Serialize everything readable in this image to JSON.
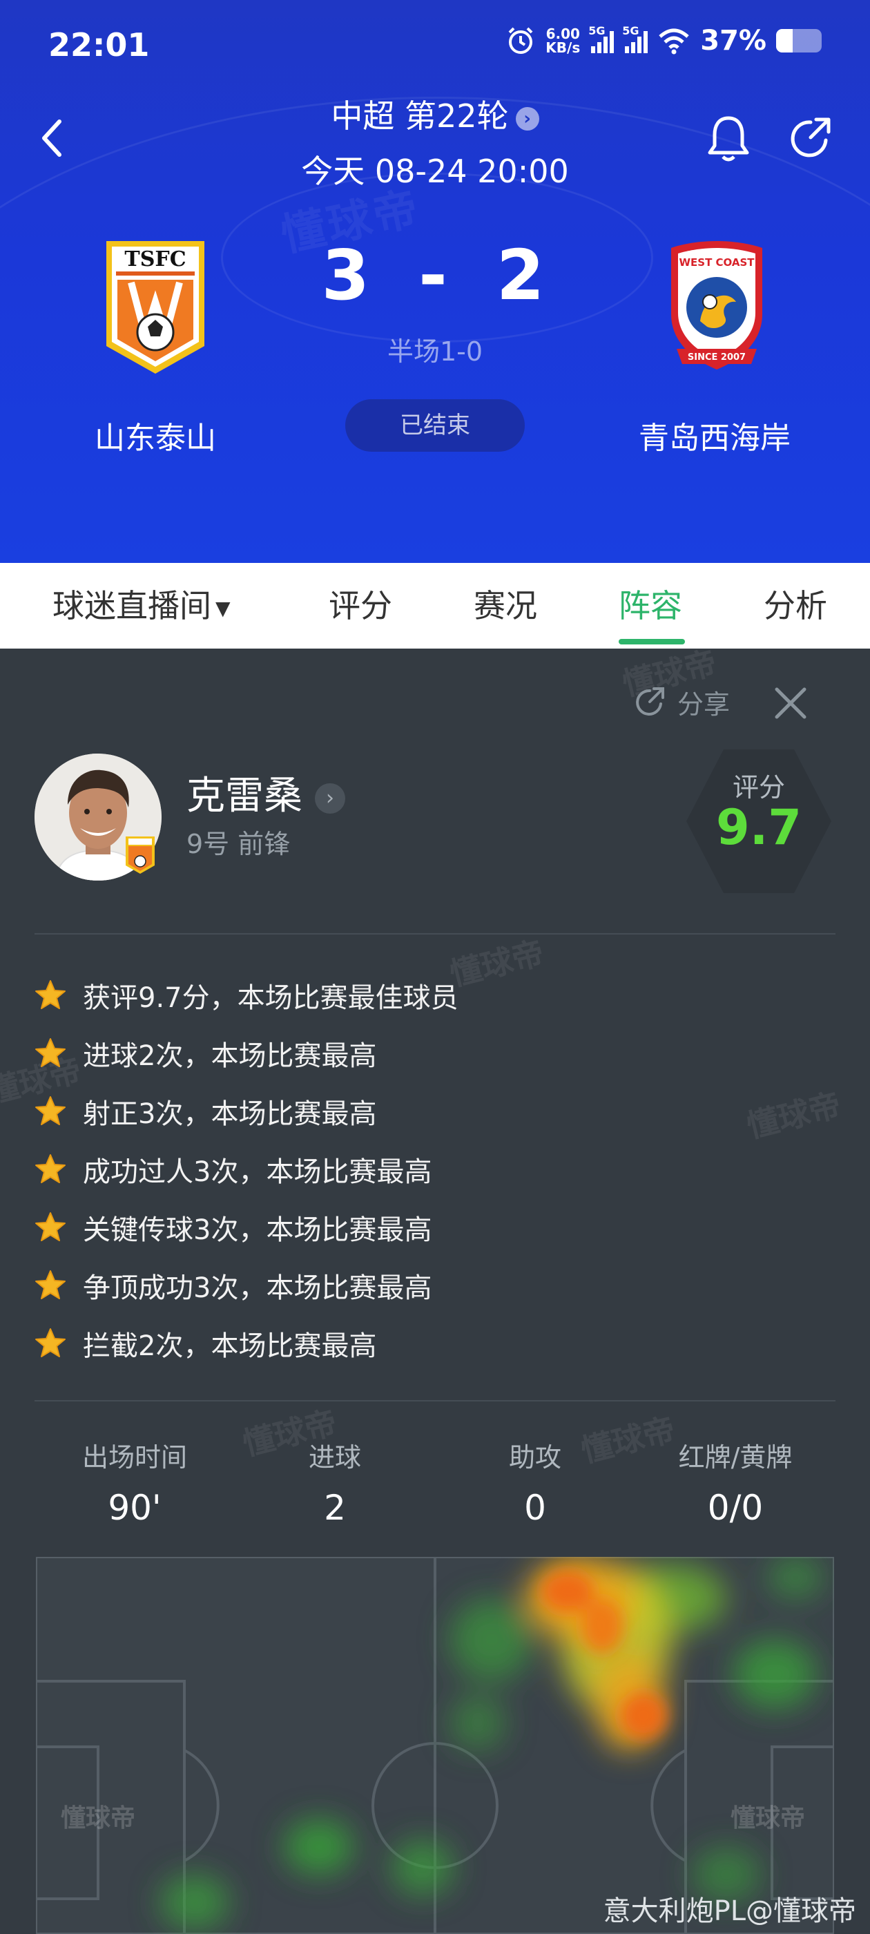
{
  "status_bar": {
    "time": "22:01",
    "net_speed_top": "6.00",
    "net_speed_unit": "KB/s",
    "sim1": "5G",
    "sim2": "5G",
    "battery": "37%",
    "battery_level": 0.37
  },
  "match": {
    "league": "中超 第22轮",
    "kickoff": "今天 08-24 20:00",
    "score_home": "3",
    "score_sep": "-",
    "score_away": "2",
    "half_time": "半场1-0",
    "status": "已结束",
    "home_team": "山东泰山",
    "away_team": "青岛西海岸",
    "home_logo_text": "TSFC",
    "away_logo_text_top": "WEST COAST",
    "away_logo_text_bottom": "SINCE 2007"
  },
  "tabs": [
    {
      "label": "球迷直播间",
      "active": false,
      "has_dropdown": true
    },
    {
      "label": "评分",
      "active": false
    },
    {
      "label": "赛况",
      "active": false
    },
    {
      "label": "阵容",
      "active": true
    },
    {
      "label": "分析",
      "active": false
    }
  ],
  "player_panel": {
    "share_label": "分享",
    "player_name": "克雷桑",
    "number_position": "9号 前锋",
    "rating_label": "评分",
    "rating_value": "9.7",
    "honors": [
      "获评9.7分，本场比赛最佳球员",
      "进球2次，本场比赛最高",
      "射正3次，本场比赛最高",
      "成功过人3次，本场比赛最高",
      "关键传球3次，本场比赛最高",
      "争顶成功3次，本场比赛最高",
      "拦截2次，本场比赛最高"
    ],
    "stats": [
      {
        "label": "出场时间",
        "value": "90'"
      },
      {
        "label": "进球",
        "value": "2"
      },
      {
        "label": "助攻",
        "value": "0"
      },
      {
        "label": "红牌/黄牌",
        "value": "0/0"
      }
    ],
    "pitch_watermark": "懂球帝"
  },
  "watermark": "懂球帝",
  "credit": "意大利炮PL@懂球帝",
  "colors": {
    "header_blue": "#1b38d8",
    "accent_green": "#2db46a",
    "rating_green": "#5ddc3b",
    "panel_bg": "#343b42"
  }
}
